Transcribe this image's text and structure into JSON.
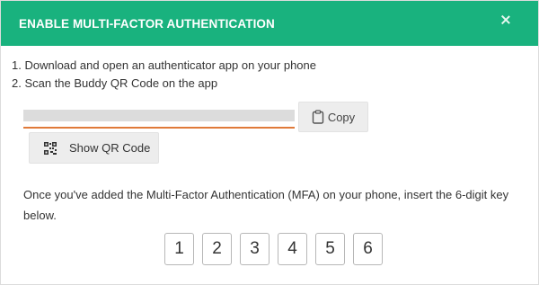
{
  "dialog": {
    "title": "ENABLE MULTI-FACTOR AUTHENTICATION",
    "close_icon": "close-icon",
    "accent_color": "#19b27e"
  },
  "steps": [
    "1. Download and open an authenticator app on your phone",
    "2. Scan the Buddy QR Code on the app"
  ],
  "copy_button": {
    "label": "Copy",
    "icon": "clipboard-icon"
  },
  "qr_button": {
    "label": "Show QR Code",
    "icon": "qr-code-icon"
  },
  "instruction": "Once you've added the Multi-Factor Authentication (MFA) on your phone, insert the 6-digit key below.",
  "code_digits": [
    "1",
    "2",
    "3",
    "4",
    "5",
    "6"
  ]
}
